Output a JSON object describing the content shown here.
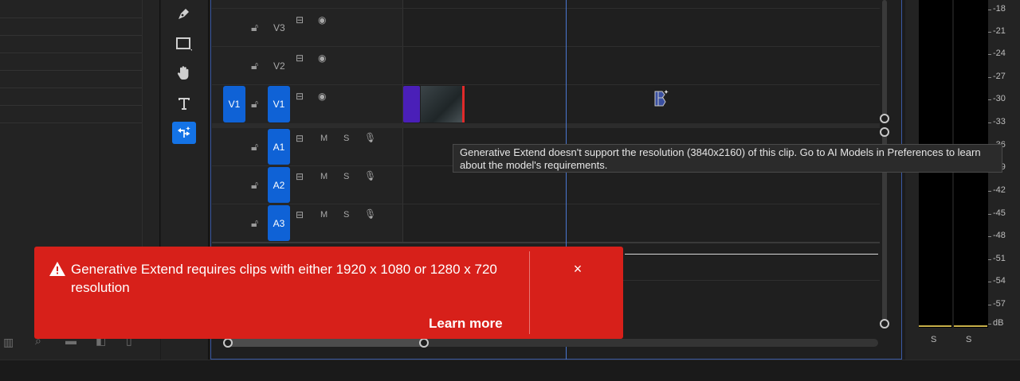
{
  "tracks": {
    "video": [
      {
        "label": "V3"
      },
      {
        "label": "V2"
      },
      {
        "label": "V1",
        "source_tag": "V1"
      }
    ],
    "audio": [
      {
        "label": "A1",
        "m": "M",
        "s": "S"
      },
      {
        "label": "A2",
        "m": "M",
        "s": "S"
      },
      {
        "label": "A3",
        "m": "M",
        "s": "S"
      }
    ]
  },
  "tooltip": {
    "text": "Generative Extend doesn't support the resolution (3840x2160) of this clip. Go to AI Models in Preferences to learn about the model's requirements."
  },
  "toast": {
    "message": "Generative Extend requires clips with either 1920 x 1080 or 1280 x 720 resolution",
    "link": "Learn more",
    "close": "×",
    "color": "#d7201a"
  },
  "meter": {
    "db_labels": [
      "-18",
      "-21",
      "-24",
      "-27",
      "-30",
      "-33",
      "-36",
      "-39",
      "-42",
      "-45",
      "-48",
      "-51",
      "-54",
      "-57",
      "dB"
    ],
    "channels": [
      "S",
      "S"
    ]
  },
  "colors": {
    "accent": "#1473e6",
    "track_tag": "#0f62d6",
    "clip": "#4a1fb8",
    "playhead": "#4a77d0"
  }
}
